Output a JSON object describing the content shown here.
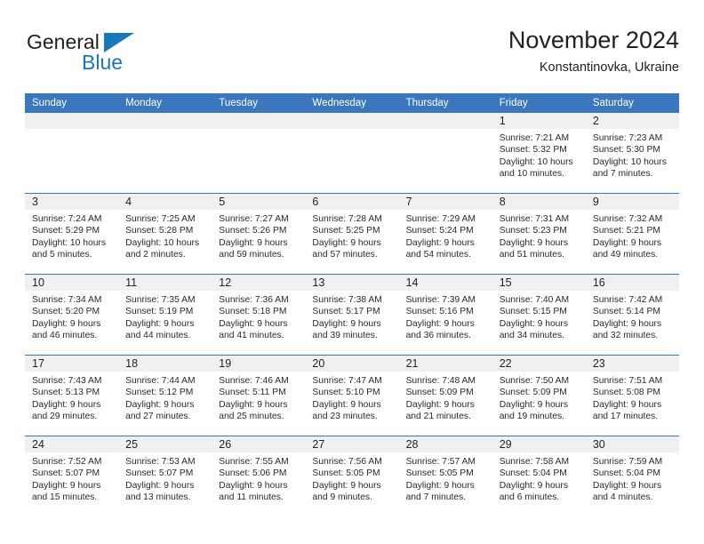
{
  "brand": {
    "name_part1": "General",
    "name_part2": "Blue",
    "accent_color": "#1878be"
  },
  "header": {
    "title": "November 2024",
    "location": "Konstantinovka, Ukraine"
  },
  "theme": {
    "header_band": "#3b77bf",
    "daynum_band": "#f0f0f0",
    "row_divider": "#3b77bf",
    "text": "#231f20"
  },
  "weekdays": [
    "Sunday",
    "Monday",
    "Tuesday",
    "Wednesday",
    "Thursday",
    "Friday",
    "Saturday"
  ],
  "labels": {
    "sunrise_prefix": "Sunrise:",
    "sunset_prefix": "Sunset:",
    "daylight_prefix": "Daylight:"
  },
  "weeks": [
    [
      {
        "day": "",
        "empty": true
      },
      {
        "day": "",
        "empty": true
      },
      {
        "day": "",
        "empty": true
      },
      {
        "day": "",
        "empty": true
      },
      {
        "day": "",
        "empty": true
      },
      {
        "day": "1",
        "sunrise": "Sunrise: 7:21 AM",
        "sunset": "Sunset: 5:32 PM",
        "daylight": "Daylight: 10 hours and 10 minutes."
      },
      {
        "day": "2",
        "sunrise": "Sunrise: 7:23 AM",
        "sunset": "Sunset: 5:30 PM",
        "daylight": "Daylight: 10 hours and 7 minutes."
      }
    ],
    [
      {
        "day": "3",
        "sunrise": "Sunrise: 7:24 AM",
        "sunset": "Sunset: 5:29 PM",
        "daylight": "Daylight: 10 hours and 5 minutes."
      },
      {
        "day": "4",
        "sunrise": "Sunrise: 7:25 AM",
        "sunset": "Sunset: 5:28 PM",
        "daylight": "Daylight: 10 hours and 2 minutes."
      },
      {
        "day": "5",
        "sunrise": "Sunrise: 7:27 AM",
        "sunset": "Sunset: 5:26 PM",
        "daylight": "Daylight: 9 hours and 59 minutes."
      },
      {
        "day": "6",
        "sunrise": "Sunrise: 7:28 AM",
        "sunset": "Sunset: 5:25 PM",
        "daylight": "Daylight: 9 hours and 57 minutes."
      },
      {
        "day": "7",
        "sunrise": "Sunrise: 7:29 AM",
        "sunset": "Sunset: 5:24 PM",
        "daylight": "Daylight: 9 hours and 54 minutes."
      },
      {
        "day": "8",
        "sunrise": "Sunrise: 7:31 AM",
        "sunset": "Sunset: 5:23 PM",
        "daylight": "Daylight: 9 hours and 51 minutes."
      },
      {
        "day": "9",
        "sunrise": "Sunrise: 7:32 AM",
        "sunset": "Sunset: 5:21 PM",
        "daylight": "Daylight: 9 hours and 49 minutes."
      }
    ],
    [
      {
        "day": "10",
        "sunrise": "Sunrise: 7:34 AM",
        "sunset": "Sunset: 5:20 PM",
        "daylight": "Daylight: 9 hours and 46 minutes."
      },
      {
        "day": "11",
        "sunrise": "Sunrise: 7:35 AM",
        "sunset": "Sunset: 5:19 PM",
        "daylight": "Daylight: 9 hours and 44 minutes."
      },
      {
        "day": "12",
        "sunrise": "Sunrise: 7:36 AM",
        "sunset": "Sunset: 5:18 PM",
        "daylight": "Daylight: 9 hours and 41 minutes."
      },
      {
        "day": "13",
        "sunrise": "Sunrise: 7:38 AM",
        "sunset": "Sunset: 5:17 PM",
        "daylight": "Daylight: 9 hours and 39 minutes."
      },
      {
        "day": "14",
        "sunrise": "Sunrise: 7:39 AM",
        "sunset": "Sunset: 5:16 PM",
        "daylight": "Daylight: 9 hours and 36 minutes."
      },
      {
        "day": "15",
        "sunrise": "Sunrise: 7:40 AM",
        "sunset": "Sunset: 5:15 PM",
        "daylight": "Daylight: 9 hours and 34 minutes."
      },
      {
        "day": "16",
        "sunrise": "Sunrise: 7:42 AM",
        "sunset": "Sunset: 5:14 PM",
        "daylight": "Daylight: 9 hours and 32 minutes."
      }
    ],
    [
      {
        "day": "17",
        "sunrise": "Sunrise: 7:43 AM",
        "sunset": "Sunset: 5:13 PM",
        "daylight": "Daylight: 9 hours and 29 minutes."
      },
      {
        "day": "18",
        "sunrise": "Sunrise: 7:44 AM",
        "sunset": "Sunset: 5:12 PM",
        "daylight": "Daylight: 9 hours and 27 minutes."
      },
      {
        "day": "19",
        "sunrise": "Sunrise: 7:46 AM",
        "sunset": "Sunset: 5:11 PM",
        "daylight": "Daylight: 9 hours and 25 minutes."
      },
      {
        "day": "20",
        "sunrise": "Sunrise: 7:47 AM",
        "sunset": "Sunset: 5:10 PM",
        "daylight": "Daylight: 9 hours and 23 minutes."
      },
      {
        "day": "21",
        "sunrise": "Sunrise: 7:48 AM",
        "sunset": "Sunset: 5:09 PM",
        "daylight": "Daylight: 9 hours and 21 minutes."
      },
      {
        "day": "22",
        "sunrise": "Sunrise: 7:50 AM",
        "sunset": "Sunset: 5:09 PM",
        "daylight": "Daylight: 9 hours and 19 minutes."
      },
      {
        "day": "23",
        "sunrise": "Sunrise: 7:51 AM",
        "sunset": "Sunset: 5:08 PM",
        "daylight": "Daylight: 9 hours and 17 minutes."
      }
    ],
    [
      {
        "day": "24",
        "sunrise": "Sunrise: 7:52 AM",
        "sunset": "Sunset: 5:07 PM",
        "daylight": "Daylight: 9 hours and 15 minutes."
      },
      {
        "day": "25",
        "sunrise": "Sunrise: 7:53 AM",
        "sunset": "Sunset: 5:07 PM",
        "daylight": "Daylight: 9 hours and 13 minutes."
      },
      {
        "day": "26",
        "sunrise": "Sunrise: 7:55 AM",
        "sunset": "Sunset: 5:06 PM",
        "daylight": "Daylight: 9 hours and 11 minutes."
      },
      {
        "day": "27",
        "sunrise": "Sunrise: 7:56 AM",
        "sunset": "Sunset: 5:05 PM",
        "daylight": "Daylight: 9 hours and 9 minutes."
      },
      {
        "day": "28",
        "sunrise": "Sunrise: 7:57 AM",
        "sunset": "Sunset: 5:05 PM",
        "daylight": "Daylight: 9 hours and 7 minutes."
      },
      {
        "day": "29",
        "sunrise": "Sunrise: 7:58 AM",
        "sunset": "Sunset: 5:04 PM",
        "daylight": "Daylight: 9 hours and 6 minutes."
      },
      {
        "day": "30",
        "sunrise": "Sunrise: 7:59 AM",
        "sunset": "Sunset: 5:04 PM",
        "daylight": "Daylight: 9 hours and 4 minutes."
      }
    ]
  ]
}
